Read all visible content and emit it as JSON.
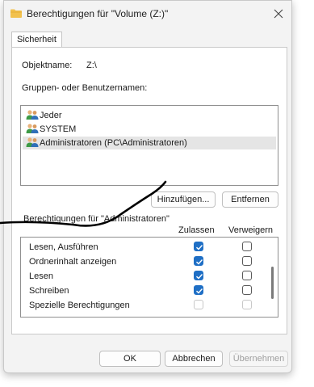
{
  "window": {
    "title": "Berechtigungen für \"Volume (Z:)\""
  },
  "tabs": [
    {
      "label": "Sicherheit"
    }
  ],
  "object": {
    "label": "Objektname:",
    "value": "Z:\\"
  },
  "groups": {
    "label": "Gruppen- oder Benutzernamen:",
    "items": [
      {
        "label": "Jeder"
      },
      {
        "label": "SYSTEM"
      },
      {
        "label": "Administratoren (PC\\Administratoren)"
      }
    ]
  },
  "buttons": {
    "add": "Hinzufügen...",
    "remove": "Entfernen",
    "ok": "OK",
    "cancel": "Abbrechen",
    "apply": "Übernehmen"
  },
  "permissions": {
    "label": "Berechtigungen für \"Administratoren\"",
    "allow_header": "Zulassen",
    "deny_header": "Verweigern",
    "rows": [
      {
        "name": "Lesen, Ausführen",
        "allow": "checked",
        "deny": "unchecked"
      },
      {
        "name": "Ordnerinhalt anzeigen",
        "allow": "checked",
        "deny": "unchecked"
      },
      {
        "name": "Lesen",
        "allow": "checked",
        "deny": "unchecked"
      },
      {
        "name": "Schreiben",
        "allow": "checked",
        "deny": "unchecked"
      },
      {
        "name": "Spezielle Berechtigungen",
        "allow": "disabled",
        "deny": "disabled"
      }
    ]
  },
  "colors": {
    "accent": "#1f6fc5",
    "selection": "#e5e5e5",
    "folder": "#f2c14e",
    "pen": "#000000"
  },
  "icons": {
    "folder": "folder-icon",
    "close": "close-icon",
    "users": "users-icon",
    "check": "check-icon"
  }
}
